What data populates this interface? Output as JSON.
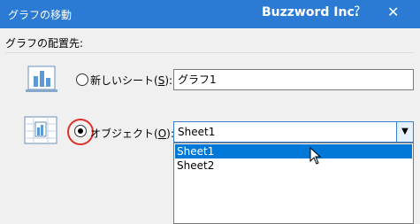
{
  "window": {
    "title": "グラフの移動",
    "watermark": "Buzzword Inc.",
    "help_glyph": "?",
    "close_glyph": "✕"
  },
  "group": {
    "label": "グラフの配置先:"
  },
  "options": {
    "new_sheet": {
      "label_main": "新しいシート(",
      "accel": "S",
      "label_end": "):",
      "value": "グラフ1"
    },
    "object": {
      "label_main": "オブジェクト(",
      "accel": "O",
      "label_end": "):",
      "value": "Sheet1"
    }
  },
  "dropdown": {
    "items": [
      "Sheet1",
      "Sheet2"
    ],
    "selected": "Sheet1"
  }
}
